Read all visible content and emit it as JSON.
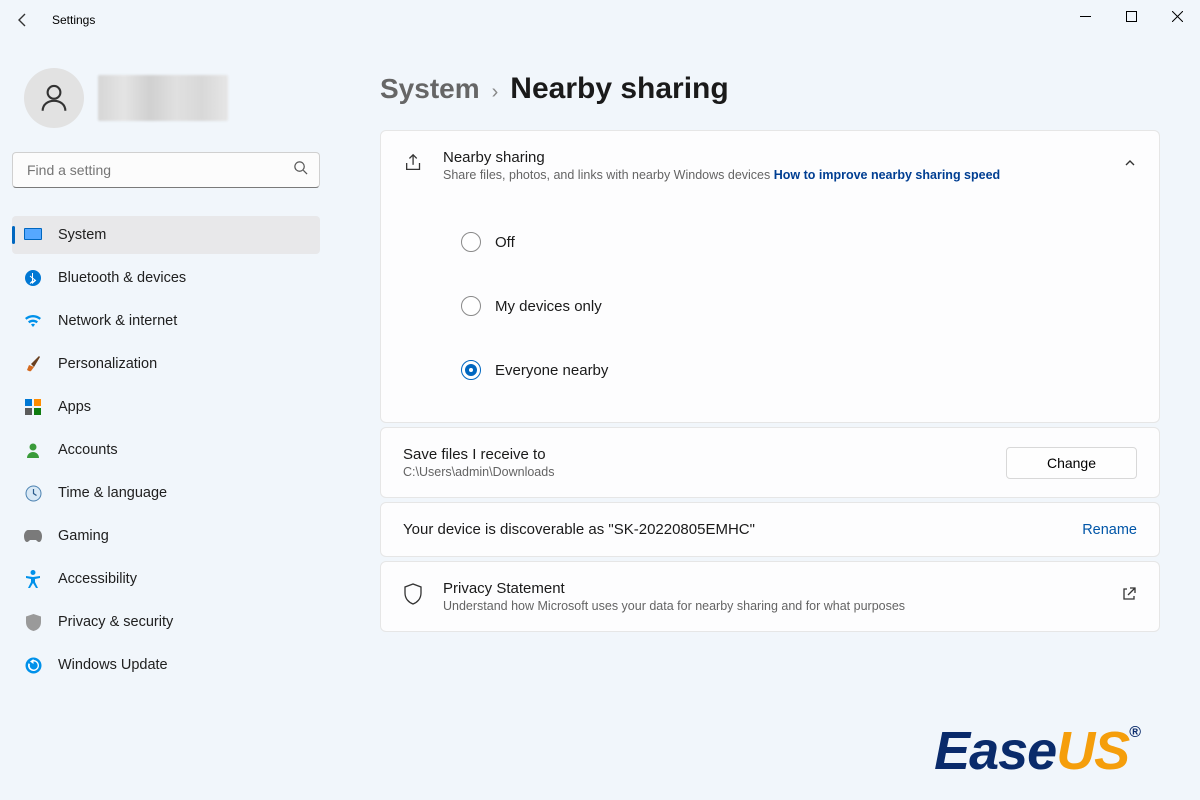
{
  "window": {
    "title": "Settings"
  },
  "search": {
    "placeholder": "Find a setting"
  },
  "nav": {
    "items": [
      {
        "label": "System"
      },
      {
        "label": "Bluetooth & devices"
      },
      {
        "label": "Network & internet"
      },
      {
        "label": "Personalization"
      },
      {
        "label": "Apps"
      },
      {
        "label": "Accounts"
      },
      {
        "label": "Time & language"
      },
      {
        "label": "Gaming"
      },
      {
        "label": "Accessibility"
      },
      {
        "label": "Privacy & security"
      },
      {
        "label": "Windows Update"
      }
    ]
  },
  "breadcrumb": {
    "parent": "System",
    "current": "Nearby sharing"
  },
  "sharing_card": {
    "title": "Nearby sharing",
    "subtitle": "Share files, photos, and links with nearby Windows devices ",
    "link": "How to improve nearby sharing speed"
  },
  "options": {
    "off": "Off",
    "mine": "My devices only",
    "everyone": "Everyone nearby",
    "selected": "everyone"
  },
  "save_to": {
    "title": "Save files I receive to",
    "path": "C:\\Users\\admin\\Downloads",
    "button": "Change"
  },
  "discover": {
    "text": "Your device is discoverable as \"SK-20220805EMHC\"",
    "button": "Rename"
  },
  "privacy": {
    "title": "Privacy Statement",
    "subtitle": "Understand how Microsoft uses your data for nearby sharing and for what purposes"
  },
  "watermark": {
    "a": "Ease",
    "b": "US",
    "r": "®"
  }
}
